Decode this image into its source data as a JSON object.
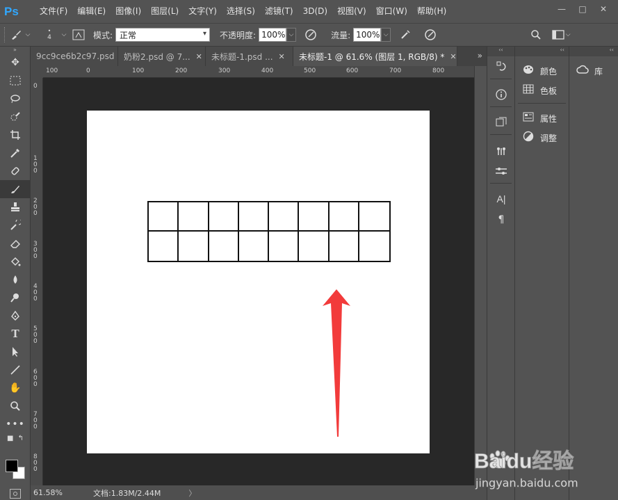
{
  "app": {
    "logo": "Ps"
  },
  "menu": [
    "文件(F)",
    "编辑(E)",
    "图像(I)",
    "图层(L)",
    "文字(Y)",
    "选择(S)",
    "滤镜(T)",
    "3D(D)",
    "视图(V)",
    "窗口(W)",
    "帮助(H)"
  ],
  "options": {
    "brush_size": "4",
    "mode_label": "模式:",
    "mode_value": "正常",
    "opacity_label": "不透明度:",
    "opacity_value": "100%",
    "flow_label": "流量:",
    "flow_value": "100%"
  },
  "tabs": [
    {
      "label": "9cc9ce6b2c97.psd",
      "active": false
    },
    {
      "label": "奶粉2.psd @ 7...",
      "active": false
    },
    {
      "label": "未标题-1.psd ...",
      "active": false
    },
    {
      "label": "未标题-1 @ 61.6% (图层 1, RGB/8) *",
      "active": true
    }
  ],
  "hruler_ticks": [
    "100",
    "0",
    "100",
    "200",
    "300",
    "400",
    "500",
    "600",
    "700",
    "800"
  ],
  "vruler_ticks": [
    "0",
    "1 0 0",
    "2 0 0",
    "3 0 0",
    "4 0 0",
    "5 0 0",
    "6 0 0",
    "7 0 0",
    "8 0 0"
  ],
  "canvas": {
    "grid_columns": 8,
    "grid_rows": 2,
    "annotation_color": "#f23b3b"
  },
  "status": {
    "zoom": "61.58%",
    "doc_info": "文档:1.83M/2.44M",
    "arrow": "〉"
  },
  "panels": {
    "group1": [
      {
        "label": "颜色",
        "icon": "palette-icon"
      },
      {
        "label": "色板",
        "icon": "swatches-icon"
      }
    ],
    "group2": [
      {
        "label": "属性",
        "icon": "properties-icon"
      },
      {
        "label": "调整",
        "icon": "adjustments-icon"
      }
    ],
    "library": {
      "label": "库",
      "icon": "cc-library-icon"
    }
  },
  "watermark": {
    "brand": "Baidu经验",
    "url": "jingyan.baidu.com"
  },
  "colors": {
    "ps_blue": "#31a8ff",
    "ui_bg": "#535353",
    "canvas_bg": "#282828"
  }
}
